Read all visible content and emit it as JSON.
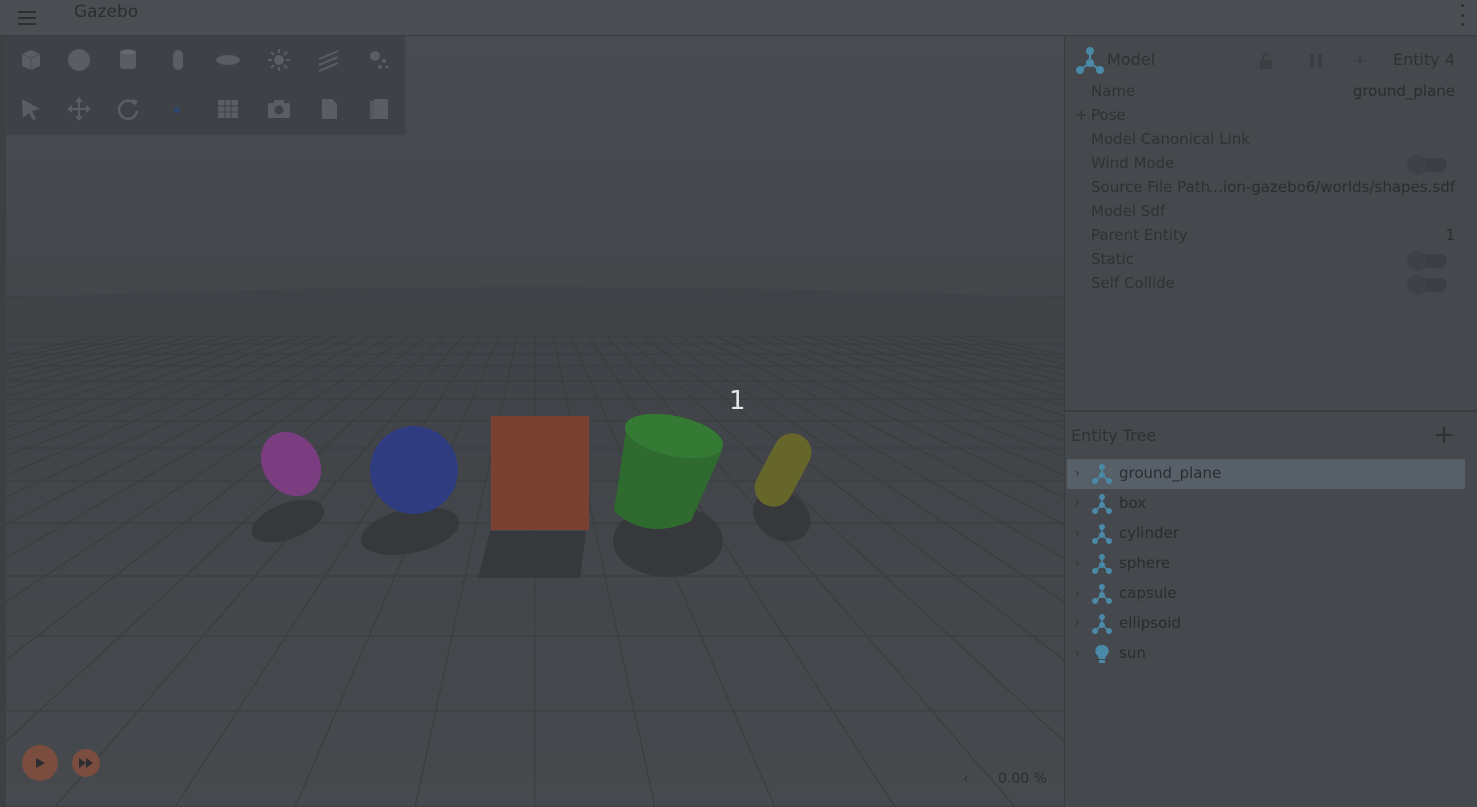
{
  "app": {
    "title": "Gazebo"
  },
  "scene": {
    "step_label": "1"
  },
  "playback": {
    "rtf_value": "0.00 %",
    "rtf_chevron": "‹"
  },
  "toolbar": {
    "row1": [
      "box-icon",
      "sphere-icon",
      "cylinder-icon",
      "capsule-icon",
      "ellipsoid-icon",
      "sun-light-icon",
      "directional-light-icon",
      "point-light-icon"
    ],
    "row2": [
      "select-arrow-icon",
      "translate-icon",
      "rotate-icon",
      "view-angle-icon",
      "grid-icon",
      "screenshot-icon",
      "copy-icon",
      "paste-icon"
    ]
  },
  "component_inspector": {
    "header": {
      "title": "Model",
      "entity": "Entity 4"
    },
    "properties": [
      {
        "label": "Name",
        "value": "ground_plane",
        "kind": "text"
      },
      {
        "label": "Pose",
        "value": "",
        "kind": "expand"
      },
      {
        "label": "Model Canonical Link",
        "value": "",
        "kind": "text"
      },
      {
        "label": "Wind Mode",
        "value": "",
        "kind": "toggle"
      },
      {
        "label": "Source File Path",
        "value": "…ion-gazebo6/worlds/shapes.sdf",
        "kind": "text"
      },
      {
        "label": "Model Sdf",
        "value": "",
        "kind": "text"
      },
      {
        "label": "Parent Entity",
        "value": "1",
        "kind": "text"
      },
      {
        "label": "Static",
        "value": "",
        "kind": "toggle"
      },
      {
        "label": "Self Collide",
        "value": "",
        "kind": "toggle"
      }
    ]
  },
  "entity_tree": {
    "title": "Entity Tree",
    "add_label": "+",
    "items": [
      {
        "label": "ground_plane",
        "icon": "model-icon",
        "selected": true
      },
      {
        "label": "box",
        "icon": "model-icon",
        "selected": false
      },
      {
        "label": "cylinder",
        "icon": "model-icon",
        "selected": false
      },
      {
        "label": "sphere",
        "icon": "model-icon",
        "selected": false
      },
      {
        "label": "capsule",
        "icon": "model-icon",
        "selected": false
      },
      {
        "label": "ellipsoid",
        "icon": "model-icon",
        "selected": false
      },
      {
        "label": "sun",
        "icon": "light-icon",
        "selected": false
      }
    ]
  },
  "colors": {
    "ellipsoid": "#7a3d80",
    "sphere": "#2f3d80",
    "box": "#7a4030",
    "cylinder": "#2f6b2f",
    "capsule": "#66662a",
    "model_icon": "#4a8aa8"
  }
}
